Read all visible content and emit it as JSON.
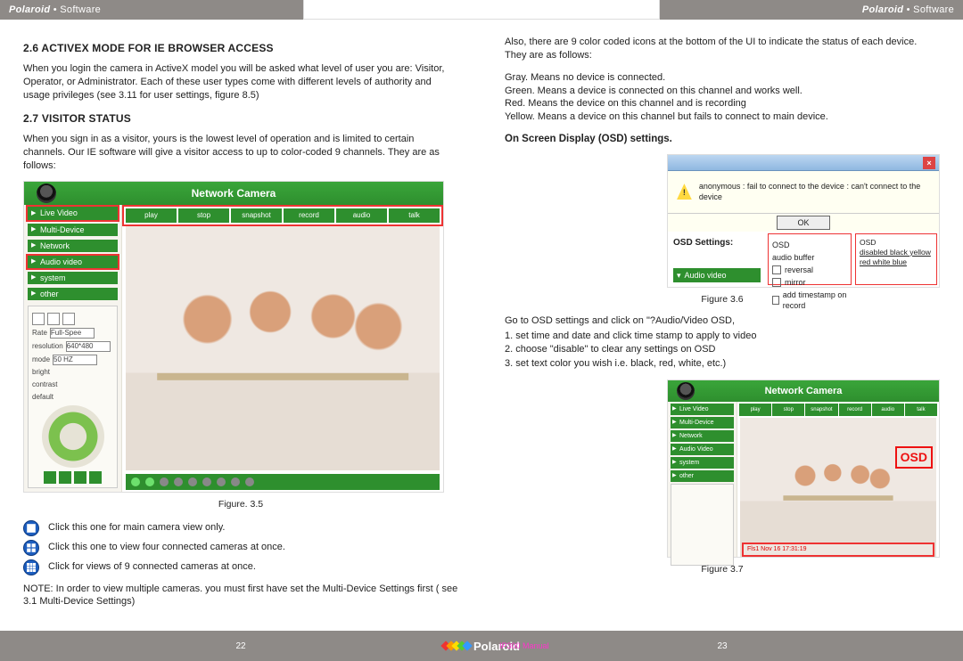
{
  "header": {
    "brand_bold": "Polaroid",
    "brand_rest": "• Software"
  },
  "left": {
    "h26": "2.6 ACTIVEX MODE FOR IE BROWSER ACCESS",
    "p26": "When you login the camera in ActiveX model you will be asked what level of user you are: Visitor, Operator, or Administrator. Each of these user types come with different levels of authority and usage privileges (see 3.11 for user settings, figure 8.5)",
    "h27": "2.7 VISITOR STATUS",
    "p27": "When you sign in as a visitor, yours is the lowest level of operation and is limited to certain channels. Our IE software will give a visitor access to up to color-coded 9 channels. They are as follows:",
    "fig_title": "Network Camera",
    "nav": [
      "Live Video",
      "Multi-Device",
      "Network",
      "Audio video",
      "system",
      "other"
    ],
    "toolbar": [
      "play",
      "stop",
      "snapshot",
      "record",
      "audio",
      "talk"
    ],
    "ctrl_labels": {
      "rate": "Rate",
      "rate_val": "Full-Spee",
      "res": "resolution",
      "res_val": "640*480",
      "mode": "mode",
      "mode_val": "50 HZ",
      "bright": "bright",
      "contrast": "contrast",
      "default": "default"
    },
    "fig35_caption": "Figure. 3.5",
    "icons": {
      "a": "Click this one for main camera view only.",
      "b": "Click this one to view four connected cameras at once.",
      "c": "Click for views of 9 connected cameras at once."
    },
    "note": "NOTE: In order to view multiple cameras. you must first have set the Multi-Device Settings first ( see 3.1 Multi-Device Settings)"
  },
  "right": {
    "intro": "Also, there are 9 color coded icons at the bottom of the UI to indicate the status of each device. They are as follows:",
    "gray": "Gray. Means no device is connected.",
    "green": "Green. Means a device is connected on this channel and works well.",
    "red": "Red. Means the device on this channel and is recording",
    "yellow": "Yellow. Means a device on this channel but fails to connect to main device.",
    "osd_h": "On Screen Display (OSD) settings.",
    "fig36": {
      "warn_msg": "anonymous : fail to connect to the device : can't connect to the device",
      "ok": "OK",
      "osd_label": "OSD Settings:",
      "audio_btn": "Audio video",
      "opts": {
        "o1": "OSD",
        "o2": "audio buffer",
        "o3": "reversal",
        "o4": "mirror",
        "o5": "add timestamp on record"
      },
      "side": {
        "t": "OSD",
        "l1": "disabled black yellow",
        "l2": "red     white  blue"
      }
    },
    "fig36_caption": "Figure 3.6",
    "goto": "Go to OSD settings and click on \"?Audio/Video OSD,",
    "steps": {
      "s1": "1. set time and date and click time stamp to apply to video",
      "s2": "2. choose \"disable\" to clear any settings on OSD",
      "s3": "3. set text color you wish i.e. black, red, white, etc.)"
    },
    "fig37": {
      "title": "Network Camera",
      "nav": [
        "Live Video",
        "Multi-Device",
        "Network",
        "Audio Video",
        "system",
        "other"
      ],
      "toolbar": [
        "play",
        "stop",
        "snapshot",
        "record",
        "audio",
        "talk"
      ],
      "osd_tag": "OSD",
      "stamp": "Fls1 Nov 16 17:31:19"
    },
    "fig37_caption": "Figure 3.7"
  },
  "footer": {
    "page_left": "22",
    "page_right": "23",
    "brand": "Polaroid",
    "manual": "IP300 Manual"
  }
}
